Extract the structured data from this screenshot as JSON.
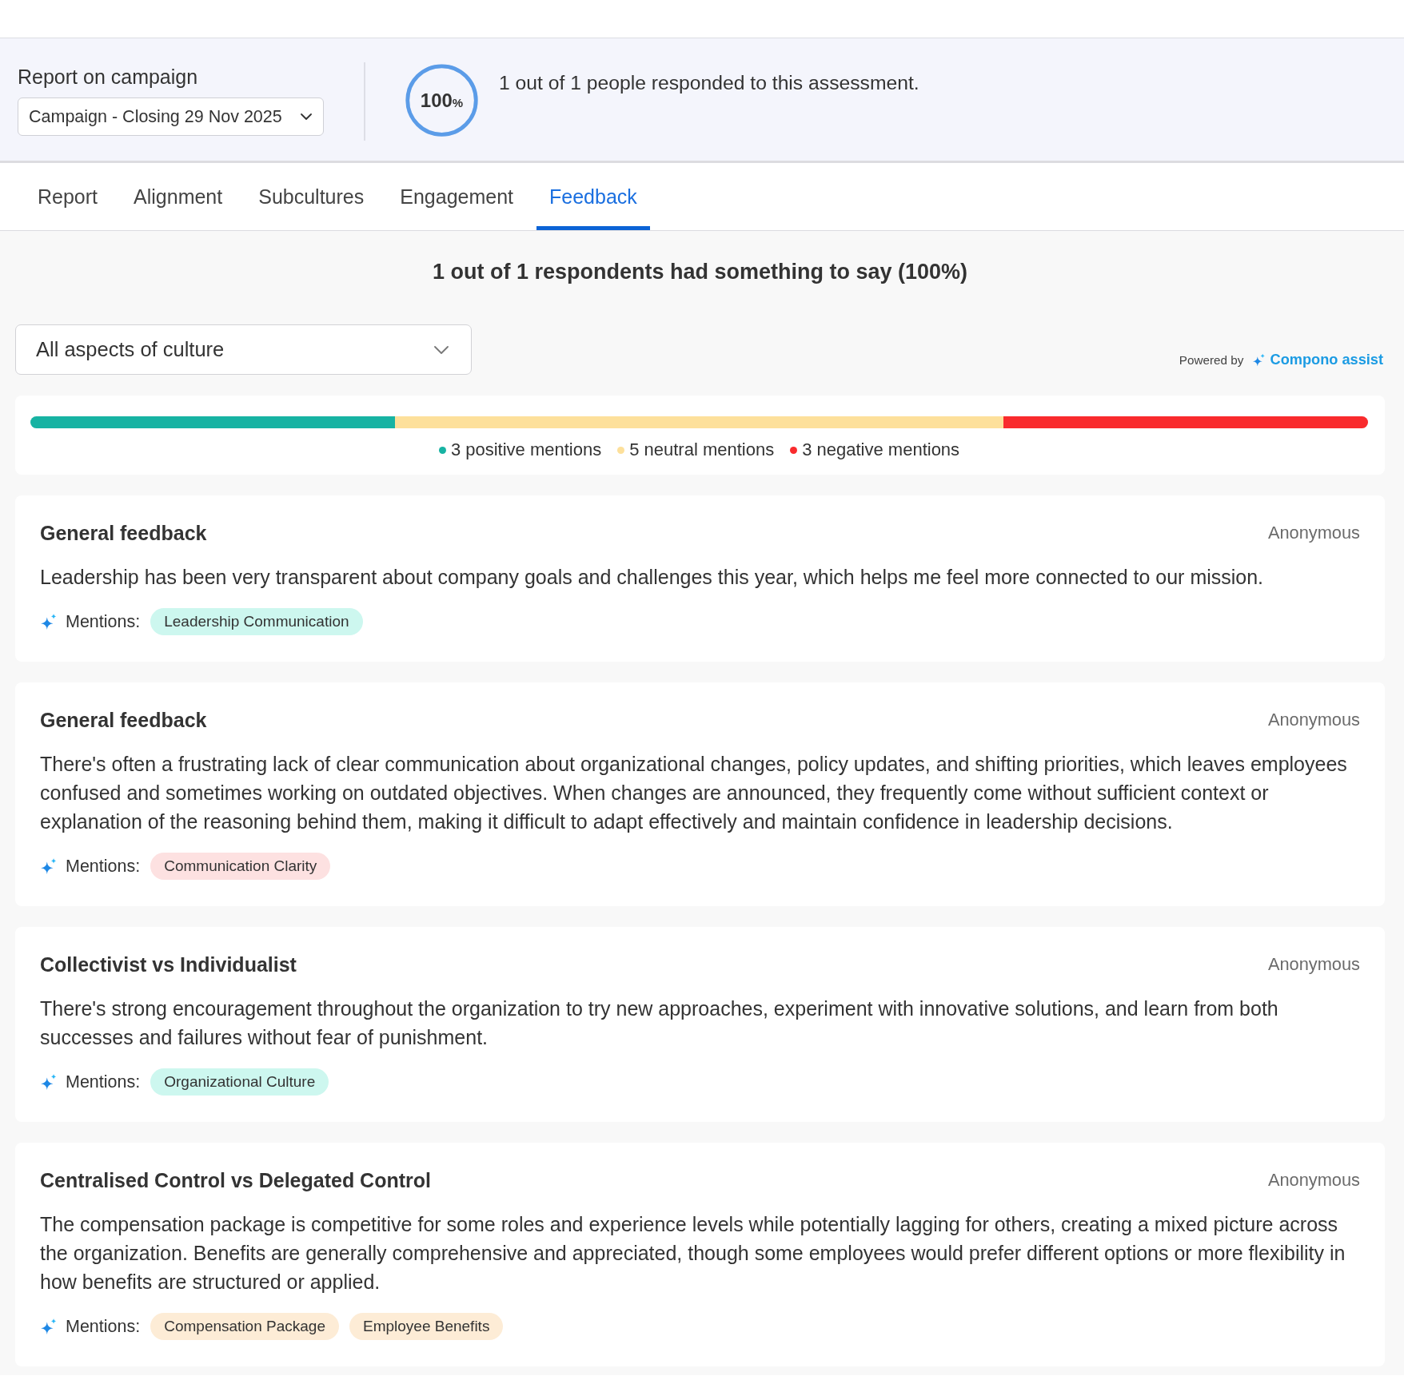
{
  "header": {
    "campaign_label": "Report on campaign",
    "campaign_select": {
      "value": "Campaign - Closing 29 Nov 2025"
    },
    "response_ring": {
      "value": "100",
      "unit": "%",
      "level": 1
    },
    "response_text": "1 out of 1 people responded to this assessment."
  },
  "tabs": [
    {
      "label": "Report",
      "selected": false
    },
    {
      "label": "Alignment",
      "selected": false
    },
    {
      "label": "Subcultures",
      "selected": false
    },
    {
      "label": "Engagement",
      "selected": false
    },
    {
      "label": "Feedback",
      "selected": true
    }
  ],
  "feedback": {
    "summary": "1 out of 1 respondents had something to say (100%)",
    "filter_select": {
      "value": "All aspects of culture"
    },
    "powered_by": {
      "label": "Powered by",
      "brand": "Compono assist"
    },
    "sentiment": {
      "segments": [
        {
          "label": "3 positive mentions",
          "color": "#17b3a3",
          "level": 0.2727
        },
        {
          "label": "5 neutral mentions",
          "color": "#fde09b",
          "level": 0.4546
        },
        {
          "label": "3 negative mentions",
          "color": "#f92b2d",
          "level": 0.2727
        }
      ]
    },
    "cards": [
      {
        "title": "General feedback",
        "author": "Anonymous",
        "text": "Leadership has been very transparent about company goals and challenges this year, which helps me feel more connected to our mission.",
        "mentions_label": "Mentions:",
        "tags": [
          {
            "label": "Leadership Communication",
            "color": "#cdf7ef"
          }
        ]
      },
      {
        "title": "General feedback",
        "author": "Anonymous",
        "text": "There's often a frustrating lack of clear communication about organizational changes, policy updates, and shifting priorities, which leaves employees confused and sometimes working on outdated objectives. When changes are announced, they frequently come without sufficient context or explanation of the reasoning behind them, making it difficult to adapt effectively and maintain confidence in leadership decisions.",
        "mentions_label": "Mentions:",
        "tags": [
          {
            "label": "Communication Clarity",
            "color": "#fde1e1"
          }
        ]
      },
      {
        "title": "Collectivist vs Individualist",
        "author": "Anonymous",
        "text": "There's strong encouragement throughout the organization to try new approaches, experiment with innovative solutions, and learn from both successes and failures without fear of punishment.",
        "mentions_label": "Mentions:",
        "tags": [
          {
            "label": "Organizational Culture",
            "color": "#cdf7ef"
          }
        ]
      },
      {
        "title": "Centralised Control vs Delegated Control",
        "author": "Anonymous",
        "text": "The compensation package is competitive for some roles and experience levels while potentially lagging for others, creating a mixed picture across the organization. Benefits are generally comprehensive and appreciated, though some employees would prefer different options or more flexibility in how benefits are structured or applied.",
        "mentions_label": "Mentions:",
        "tags": [
          {
            "label": "Compensation Package",
            "color": "#fdecd6"
          },
          {
            "label": "Employee Benefits",
            "color": "#fdecd6"
          }
        ]
      }
    ]
  }
}
